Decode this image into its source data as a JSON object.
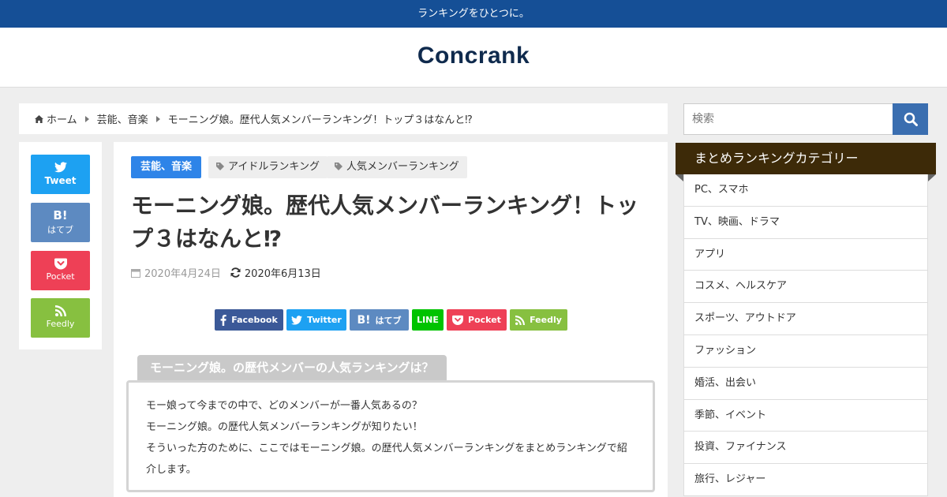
{
  "topbar": {
    "tagline": "ランキングをひとつに。"
  },
  "header": {
    "logo": "Concrank"
  },
  "breadcrumb": {
    "home": "ホーム",
    "category": "芸能、音楽",
    "current": "モーニング娘。歴代人気メンバーランキング！トップ３はなんと⁉"
  },
  "share_side": {
    "twitter": "Tweet",
    "hatena_mark": "B!",
    "hatena": "はてブ",
    "pocket": "Pocket",
    "feedly": "Feedly"
  },
  "article": {
    "category": "芸能、音楽",
    "tags": [
      "アイドルランキング",
      "人気メンバーランキング"
    ],
    "title": "モーニング娘。歴代人気メンバーランキング！トップ３はなんと⁉",
    "published": "2020年4月24日",
    "updated": "2020年6月13日"
  },
  "share_bar": {
    "facebook": "Facebook",
    "twitter": "Twitter",
    "hatena_mark": "B!",
    "hatena": "はてブ",
    "line": "LINE",
    "pocket": "Pocket",
    "feedly": "Feedly"
  },
  "section": {
    "heading": "モーニング娘。の歴代メンバーの人気ランキングは？",
    "lines": [
      "モー娘って今までの中で、どのメンバーが一番人気あるの？",
      "モーニング娘。の歴代人気メンバーランキングが知りたい！",
      "そういった方のために、ここではモーニング娘。の歴代人気メンバーランキングをまとめランキングで紹",
      "介します。"
    ]
  },
  "sidebar": {
    "search_placeholder": "検索",
    "widget_title": "まとめランキングカテゴリー",
    "categories": [
      "PC、スマホ",
      "TV、映画、ドラマ",
      "アプリ",
      "コスメ、ヘルスケア",
      "スポーツ、アウトドア",
      "ファッション",
      "婚活、出会い",
      "季節、イベント",
      "投資、ファイナンス",
      "旅行、レジャー"
    ]
  },
  "colors": {
    "topbar": "#154f96",
    "logo": "#0f2a4d",
    "category": "#2e84e8",
    "twitter": "#1da1f2",
    "hatena": "#5d8ac1",
    "pocket": "#ee4056",
    "feedly": "#87c040",
    "facebook": "#3b5998",
    "line": "#00c300",
    "widget_title": "#3d2a08"
  }
}
